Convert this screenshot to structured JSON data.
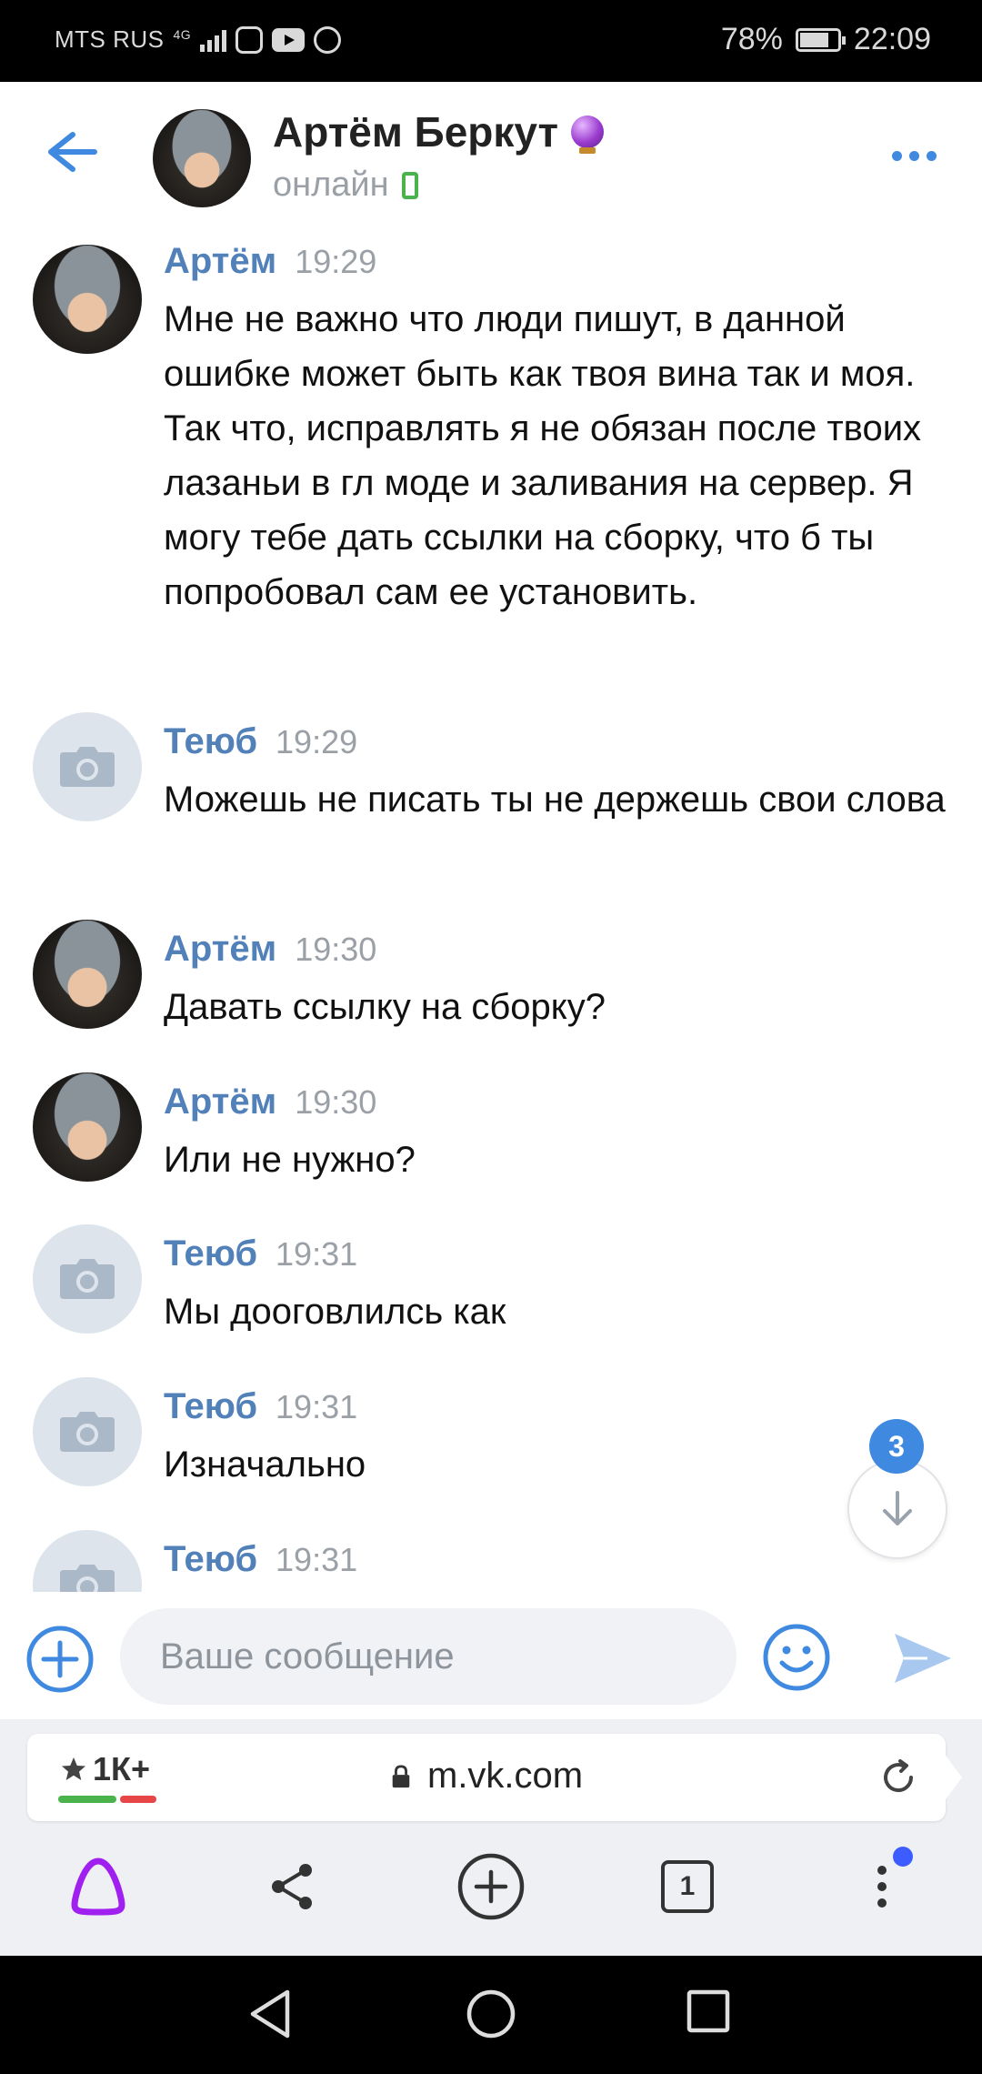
{
  "status_bar": {
    "carrier": "MTS RUS",
    "network": "4G",
    "battery": "78%",
    "battery_level": 0.78,
    "time": "22:09",
    "icons": [
      "signal-icon",
      "instagram-icon",
      "youtube-icon",
      "whatsapp-icon",
      "battery-icon"
    ]
  },
  "header": {
    "name": "Артём Беркут",
    "status": "онлайн",
    "icons": [
      "back-arrow-icon",
      "crystal-ball-icon",
      "mobile-online-icon",
      "more-dots-icon"
    ]
  },
  "messages": [
    {
      "author": "Артём",
      "time": "19:29",
      "avatar": "photo",
      "text": "Мне не важно что люди пишут, в данной ошибке может быть как твоя вина так и моя. Так что, исправлять я не обязан после твоих лазаньи в гл моде и заливания на сервер. Я могу тебе дать ссылки на сборку, что б ты попробовал сам ее установить."
    },
    {
      "author": "Теюб",
      "time": "19:29",
      "avatar": "camera",
      "text": "Можешь не писать ты не держешь свои слова"
    },
    {
      "author": "Артём",
      "time": "19:30",
      "avatar": "photo",
      "text": "Давать ссылку на сборку?"
    },
    {
      "author": "Артём",
      "time": "19:30",
      "avatar": "photo",
      "text": "Или не нужно?"
    },
    {
      "author": "Теюб",
      "time": "19:31",
      "avatar": "camera",
      "text": "Мы дооговлилсь как"
    },
    {
      "author": "Теюб",
      "time": "19:31",
      "avatar": "camera",
      "text": "Изначально"
    },
    {
      "author": "Теюб",
      "time": "19:31",
      "avatar": "camera",
      "text": ""
    }
  ],
  "scroll_down": {
    "unread_count": "3"
  },
  "composer": {
    "placeholder": "Ваше сообщение",
    "value": ""
  },
  "browser": {
    "rating": "1К+",
    "url": "m.vk.com",
    "tabs_count": "1"
  },
  "colors": {
    "accent": "#3f8ae0",
    "author": "#5181b8",
    "online": "#4bb34b",
    "alice": "#a020f0",
    "rating_green": "#4bb34b",
    "rating_red": "#e64646"
  }
}
